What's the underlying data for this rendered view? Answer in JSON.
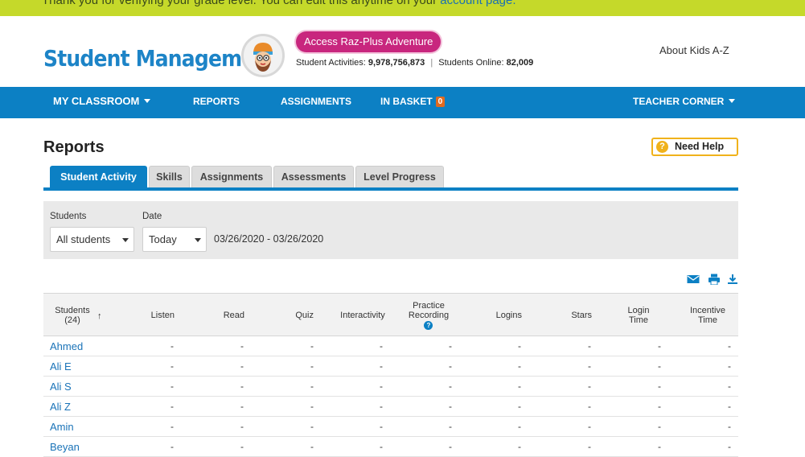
{
  "notice": {
    "text": "Thank you for verifying your grade level. You can edit this anytime on your ",
    "link": "account page."
  },
  "header": {
    "brand": "Student Management",
    "adventure_button": "Access Raz-Plus Adventure",
    "stats": {
      "activities_label": "Student Activities:",
      "activities_value": "9,978,756,873",
      "separator": "|",
      "online_label": "Students Online:",
      "online_value": "82,009"
    },
    "about_link": "About Kids A-Z"
  },
  "nav": {
    "my_classroom": "MY CLASSROOM",
    "reports": "REPORTS",
    "assignments": "ASSIGNMENTS",
    "in_basket": "IN BASKET",
    "in_basket_count": "0",
    "teacher_corner": "TEACHER CORNER"
  },
  "page": {
    "title": "Reports",
    "help_button": "Need Help"
  },
  "tabs": [
    "Student Activity",
    "Skills",
    "Assignments",
    "Assessments",
    "Level Progress"
  ],
  "filters": {
    "students_label": "Students",
    "students_value": "All students",
    "date_label": "Date",
    "date_value": "Today",
    "date_range": "03/26/2020 - 03/26/2020"
  },
  "table": {
    "headers": {
      "students": "Students",
      "students_count": "(24)",
      "listen": "Listen",
      "read": "Read",
      "quiz": "Quiz",
      "interactivity": "Interactivity",
      "practice_line1": "Practice",
      "practice_line2": "Recording",
      "logins": "Logins",
      "stars": "Stars",
      "login_line1": "Login",
      "login_line2": "Time",
      "incentive_line1": "Incentive",
      "incentive_line2": "Time"
    },
    "rows": [
      {
        "name": "Ahmed",
        "v": [
          "-",
          "-",
          "-",
          "-",
          "-",
          "-",
          "-",
          "-",
          "-"
        ]
      },
      {
        "name": "Ali E",
        "v": [
          "-",
          "-",
          "-",
          "-",
          "-",
          "-",
          "-",
          "-",
          "-"
        ]
      },
      {
        "name": "Ali S",
        "v": [
          "-",
          "-",
          "-",
          "-",
          "-",
          "-",
          "-",
          "-",
          "-"
        ]
      },
      {
        "name": "Ali Z",
        "v": [
          "-",
          "-",
          "-",
          "-",
          "-",
          "-",
          "-",
          "-",
          "-"
        ]
      },
      {
        "name": "Amin",
        "v": [
          "-",
          "-",
          "-",
          "-",
          "-",
          "-",
          "-",
          "-",
          "-"
        ]
      },
      {
        "name": "Beyan",
        "v": [
          "-",
          "-",
          "-",
          "-",
          "-",
          "-",
          "-",
          "-",
          "-"
        ]
      }
    ]
  },
  "colors": {
    "primary": "#0c80c4",
    "notice": "#c5d92a",
    "adventure": "#c8267e",
    "help": "#f0b21b",
    "badge": "#e06a1f"
  }
}
